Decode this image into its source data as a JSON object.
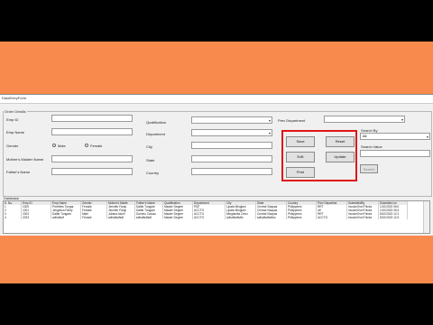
{
  "window": {
    "title": "DataEntryForm"
  },
  "order_details": {
    "group_title": "Order Details",
    "emp_id_label": "Emp ID",
    "emp_name_label": "Emp Name",
    "gender_label": "Gender",
    "gender_male": "Male",
    "gender_female": "Female",
    "mother_maiden_label": "Mother's Maiden Name",
    "father_name_label": "Father's Name",
    "qualification_label": "Qualification",
    "department_label": "Department",
    "city_label": "City",
    "state_label": "State",
    "country_label": "Country",
    "prev_department_label": "Prev Department",
    "search_by_label": "Search By",
    "search_by_value": "All",
    "search_value_label": "Search Value",
    "search_button": "Search"
  },
  "buttons": {
    "save": "Save",
    "reset": "Reset",
    "edit": "Edit",
    "update": "Update",
    "print": "Print"
  },
  "database": {
    "title": "Database",
    "columns": [
      "S. No.",
      "Emp ID",
      "Emp Name",
      "Gender",
      "Mother's Maide",
      "Father's Name",
      "Qualification",
      "Department",
      "City",
      "State",
      "Country",
      "Prev Departme",
      "SubmittedBy",
      "Submitted on"
    ],
    "rows": [
      [
        "1",
        "1000",
        "Preethes Tungar",
        "Female",
        "Jennifer Fanju",
        "Dattie Tungare",
        "Master Degree",
        "PDF",
        "Lipata Minglani",
        "Central Visayas",
        "Philippines",
        "RRT",
        "invoiceOverThinks",
        "1/10/2023 06:0"
      ],
      [
        "2",
        "1001",
        "Jengelica Fabry",
        "Female",
        "Jennifer Fanju",
        "Dattie Tungare",
        "Master Degree",
        "ACCTG",
        "Lipata Minglani",
        "Central Visayas",
        "Philippines",
        "off",
        "invoiceOverThinks",
        "1/10/2023 09:3"
      ],
      [
        "3",
        "2002",
        "Dattie Tungare",
        "Male",
        "Juliana Alcell",
        "Domino Catuzu",
        "Master Degree",
        "ACCTG",
        "Minglanilla Cebu",
        "Central Visayas",
        "Philippines",
        "RRT",
        "invoiceOverThinks",
        "5/10/2023 12:1"
      ],
      [
        "4",
        "2023",
        "sdfsdfsdf",
        "Female",
        "sdfsdfsdfsdf",
        "sdfsdfsdfsdf",
        "Master Degree",
        "ACCTG",
        "sdfsdfsdfsdfs",
        "sdfsdfsdfsdfsd",
        "Philippines",
        "ACCTG",
        "invoiceOverThinks",
        "5/10/2023 12:3"
      ]
    ]
  }
}
